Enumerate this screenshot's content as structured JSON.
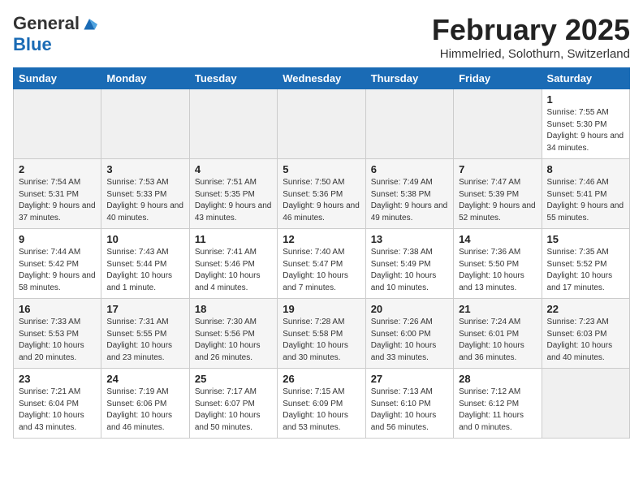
{
  "logo": {
    "general": "General",
    "blue": "Blue"
  },
  "header": {
    "month": "February 2025",
    "location": "Himmelried, Solothurn, Switzerland"
  },
  "weekdays": [
    "Sunday",
    "Monday",
    "Tuesday",
    "Wednesday",
    "Thursday",
    "Friday",
    "Saturday"
  ],
  "weeks": [
    [
      {
        "day": "",
        "info": ""
      },
      {
        "day": "",
        "info": ""
      },
      {
        "day": "",
        "info": ""
      },
      {
        "day": "",
        "info": ""
      },
      {
        "day": "",
        "info": ""
      },
      {
        "day": "",
        "info": ""
      },
      {
        "day": "1",
        "info": "Sunrise: 7:55 AM\nSunset: 5:30 PM\nDaylight: 9 hours and 34 minutes."
      }
    ],
    [
      {
        "day": "2",
        "info": "Sunrise: 7:54 AM\nSunset: 5:31 PM\nDaylight: 9 hours and 37 minutes."
      },
      {
        "day": "3",
        "info": "Sunrise: 7:53 AM\nSunset: 5:33 PM\nDaylight: 9 hours and 40 minutes."
      },
      {
        "day": "4",
        "info": "Sunrise: 7:51 AM\nSunset: 5:35 PM\nDaylight: 9 hours and 43 minutes."
      },
      {
        "day": "5",
        "info": "Sunrise: 7:50 AM\nSunset: 5:36 PM\nDaylight: 9 hours and 46 minutes."
      },
      {
        "day": "6",
        "info": "Sunrise: 7:49 AM\nSunset: 5:38 PM\nDaylight: 9 hours and 49 minutes."
      },
      {
        "day": "7",
        "info": "Sunrise: 7:47 AM\nSunset: 5:39 PM\nDaylight: 9 hours and 52 minutes."
      },
      {
        "day": "8",
        "info": "Sunrise: 7:46 AM\nSunset: 5:41 PM\nDaylight: 9 hours and 55 minutes."
      }
    ],
    [
      {
        "day": "9",
        "info": "Sunrise: 7:44 AM\nSunset: 5:42 PM\nDaylight: 9 hours and 58 minutes."
      },
      {
        "day": "10",
        "info": "Sunrise: 7:43 AM\nSunset: 5:44 PM\nDaylight: 10 hours and 1 minute."
      },
      {
        "day": "11",
        "info": "Sunrise: 7:41 AM\nSunset: 5:46 PM\nDaylight: 10 hours and 4 minutes."
      },
      {
        "day": "12",
        "info": "Sunrise: 7:40 AM\nSunset: 5:47 PM\nDaylight: 10 hours and 7 minutes."
      },
      {
        "day": "13",
        "info": "Sunrise: 7:38 AM\nSunset: 5:49 PM\nDaylight: 10 hours and 10 minutes."
      },
      {
        "day": "14",
        "info": "Sunrise: 7:36 AM\nSunset: 5:50 PM\nDaylight: 10 hours and 13 minutes."
      },
      {
        "day": "15",
        "info": "Sunrise: 7:35 AM\nSunset: 5:52 PM\nDaylight: 10 hours and 17 minutes."
      }
    ],
    [
      {
        "day": "16",
        "info": "Sunrise: 7:33 AM\nSunset: 5:53 PM\nDaylight: 10 hours and 20 minutes."
      },
      {
        "day": "17",
        "info": "Sunrise: 7:31 AM\nSunset: 5:55 PM\nDaylight: 10 hours and 23 minutes."
      },
      {
        "day": "18",
        "info": "Sunrise: 7:30 AM\nSunset: 5:56 PM\nDaylight: 10 hours and 26 minutes."
      },
      {
        "day": "19",
        "info": "Sunrise: 7:28 AM\nSunset: 5:58 PM\nDaylight: 10 hours and 30 minutes."
      },
      {
        "day": "20",
        "info": "Sunrise: 7:26 AM\nSunset: 6:00 PM\nDaylight: 10 hours and 33 minutes."
      },
      {
        "day": "21",
        "info": "Sunrise: 7:24 AM\nSunset: 6:01 PM\nDaylight: 10 hours and 36 minutes."
      },
      {
        "day": "22",
        "info": "Sunrise: 7:23 AM\nSunset: 6:03 PM\nDaylight: 10 hours and 40 minutes."
      }
    ],
    [
      {
        "day": "23",
        "info": "Sunrise: 7:21 AM\nSunset: 6:04 PM\nDaylight: 10 hours and 43 minutes."
      },
      {
        "day": "24",
        "info": "Sunrise: 7:19 AM\nSunset: 6:06 PM\nDaylight: 10 hours and 46 minutes."
      },
      {
        "day": "25",
        "info": "Sunrise: 7:17 AM\nSunset: 6:07 PM\nDaylight: 10 hours and 50 minutes."
      },
      {
        "day": "26",
        "info": "Sunrise: 7:15 AM\nSunset: 6:09 PM\nDaylight: 10 hours and 53 minutes."
      },
      {
        "day": "27",
        "info": "Sunrise: 7:13 AM\nSunset: 6:10 PM\nDaylight: 10 hours and 56 minutes."
      },
      {
        "day": "28",
        "info": "Sunrise: 7:12 AM\nSunset: 6:12 PM\nDaylight: 11 hours and 0 minutes."
      },
      {
        "day": "",
        "info": ""
      }
    ]
  ]
}
